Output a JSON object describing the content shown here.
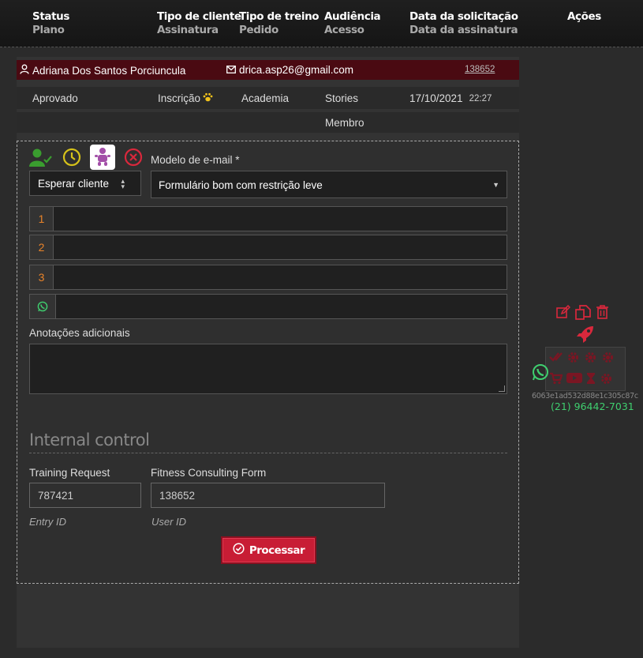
{
  "header": {
    "cols": [
      {
        "t1": "Status",
        "t2": "Plano"
      },
      {
        "t1": "Tipo de cliente",
        "t2": "Assinatura"
      },
      {
        "t1": "Tipo de treino",
        "t2": "Pedido"
      },
      {
        "t1": "Audiência",
        "t2": "Acesso"
      },
      {
        "t1": "Data da solicitação",
        "t2": "Data da assinatura"
      },
      {
        "t1": "Ações",
        "t2": ""
      }
    ]
  },
  "record": {
    "name": "Adriana Dos Santos Porciuncula",
    "email": "drica.asp26@gmail.com",
    "user_id": "138652",
    "status": "Aprovado",
    "client_type": "Inscrição",
    "training_type": "Academia",
    "audience": "Stories",
    "request_date": "17/10/2021",
    "request_time": "22:27",
    "access": "Membro"
  },
  "form": {
    "status_select": "Esperar cliente",
    "email_template_label": "Modelo de e-mail *",
    "email_template_value": "Formulário bom com restrição leve",
    "fields": [
      "1",
      "2",
      "3"
    ],
    "notes_label": "Anotações adicionais",
    "internal_title": "Internal control",
    "training_request_label": "Training Request",
    "training_request_value": "787421",
    "entry_id_label": "Entry ID",
    "fitness_form_label": "Fitness Consulting Form",
    "fitness_form_value": "138652",
    "user_id_label": "User ID",
    "submit_label": "Processar"
  },
  "actions": {
    "hash": "6063e1ad532d88e1c305c87c",
    "phone": "(21) 96442-7031"
  },
  "colors": {
    "accent_red": "#c81d35",
    "whatsapp_green": "#3fcf6f",
    "badge_orange": "#e8832a"
  }
}
